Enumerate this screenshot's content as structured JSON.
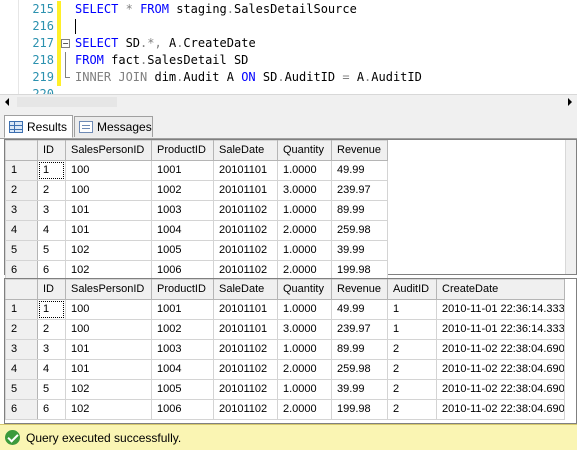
{
  "editor": {
    "lines": [
      {
        "num": "215",
        "tokens": [
          {
            "t": "SELECT",
            "c": "kw"
          },
          {
            "t": " ",
            "c": "ob"
          },
          {
            "t": "*",
            "c": "gr"
          },
          {
            "t": " ",
            "c": "ob"
          },
          {
            "t": "FROM",
            "c": "kw"
          },
          {
            "t": " staging",
            "c": "ob"
          },
          {
            "t": ".",
            "c": "gr"
          },
          {
            "t": "SalesDetailSource",
            "c": "ob"
          }
        ]
      },
      {
        "num": "216",
        "tokens": []
      },
      {
        "num": "217",
        "tokens": [
          {
            "t": "SELECT",
            "c": "kw"
          },
          {
            "t": " SD",
            "c": "ob"
          },
          {
            "t": ".*,",
            "c": "gr"
          },
          {
            "t": " A",
            "c": "ob"
          },
          {
            "t": ".",
            "c": "gr"
          },
          {
            "t": "CreateDate",
            "c": "ob"
          }
        ]
      },
      {
        "num": "218",
        "tokens": [
          {
            "t": "FROM",
            "c": "kw"
          },
          {
            "t": " fact",
            "c": "ob"
          },
          {
            "t": ".",
            "c": "gr"
          },
          {
            "t": "SalesDetail SD",
            "c": "ob"
          }
        ]
      },
      {
        "num": "219",
        "tokens": [
          {
            "t": "INNER JOIN",
            "c": "gr"
          },
          {
            "t": " dim",
            "c": "ob"
          },
          {
            "t": ".",
            "c": "gr"
          },
          {
            "t": "Audit A ",
            "c": "ob"
          },
          {
            "t": "ON",
            "c": "kw"
          },
          {
            "t": " SD",
            "c": "ob"
          },
          {
            "t": ".",
            "c": "gr"
          },
          {
            "t": "AuditID ",
            "c": "ob"
          },
          {
            "t": "=",
            "c": "gr"
          },
          {
            "t": " A",
            "c": "ob"
          },
          {
            "t": ".",
            "c": "gr"
          },
          {
            "t": "AuditID",
            "c": "ob"
          }
        ]
      },
      {
        "num": "220",
        "tokens": []
      }
    ]
  },
  "tabs": [
    {
      "label": "Results",
      "icon": "grid-icon",
      "active": true
    },
    {
      "label": "Messages",
      "icon": "messages-icon",
      "active": false
    }
  ],
  "grid1": {
    "columns": [
      "ID",
      "SalesPersonID",
      "ProductID",
      "SaleDate",
      "Quantity",
      "Revenue"
    ],
    "rows": [
      {
        "n": "1",
        "cells": [
          "1",
          "100",
          "1001",
          "20101101",
          "1.0000",
          "49.99"
        ]
      },
      {
        "n": "2",
        "cells": [
          "2",
          "100",
          "1002",
          "20101101",
          "3.0000",
          "239.97"
        ]
      },
      {
        "n": "3",
        "cells": [
          "3",
          "101",
          "1003",
          "20101102",
          "1.0000",
          "89.99"
        ]
      },
      {
        "n": "4",
        "cells": [
          "4",
          "101",
          "1004",
          "20101102",
          "2.0000",
          "259.98"
        ]
      },
      {
        "n": "5",
        "cells": [
          "5",
          "102",
          "1005",
          "20101102",
          "1.0000",
          "39.99"
        ]
      },
      {
        "n": "6",
        "cells": [
          "6",
          "102",
          "1006",
          "20101102",
          "2.0000",
          "199.98"
        ]
      }
    ]
  },
  "grid2": {
    "columns": [
      "ID",
      "SalesPersonID",
      "ProductID",
      "SaleDate",
      "Quantity",
      "Revenue",
      "AuditID",
      "CreateDate"
    ],
    "rows": [
      {
        "n": "1",
        "cells": [
          "1",
          "100",
          "1001",
          "20101101",
          "1.0000",
          "49.99",
          "1",
          "2010-11-01 22:36:14.333"
        ]
      },
      {
        "n": "2",
        "cells": [
          "2",
          "100",
          "1002",
          "20101101",
          "3.0000",
          "239.97",
          "1",
          "2010-11-01 22:36:14.333"
        ]
      },
      {
        "n": "3",
        "cells": [
          "3",
          "101",
          "1003",
          "20101102",
          "1.0000",
          "89.99",
          "2",
          "2010-11-02 22:38:04.690"
        ]
      },
      {
        "n": "4",
        "cells": [
          "4",
          "101",
          "1004",
          "20101102",
          "2.0000",
          "259.98",
          "2",
          "2010-11-02 22:38:04.690"
        ]
      },
      {
        "n": "5",
        "cells": [
          "5",
          "102",
          "1005",
          "20101102",
          "1.0000",
          "39.99",
          "2",
          "2010-11-02 22:38:04.690"
        ]
      },
      {
        "n": "6",
        "cells": [
          "6",
          "102",
          "1006",
          "20101102",
          "2.0000",
          "199.98",
          "2",
          "2010-11-02 22:38:04.690"
        ]
      }
    ]
  },
  "status": {
    "text": "Query executed successfully.",
    "icon": "success-check-icon"
  }
}
